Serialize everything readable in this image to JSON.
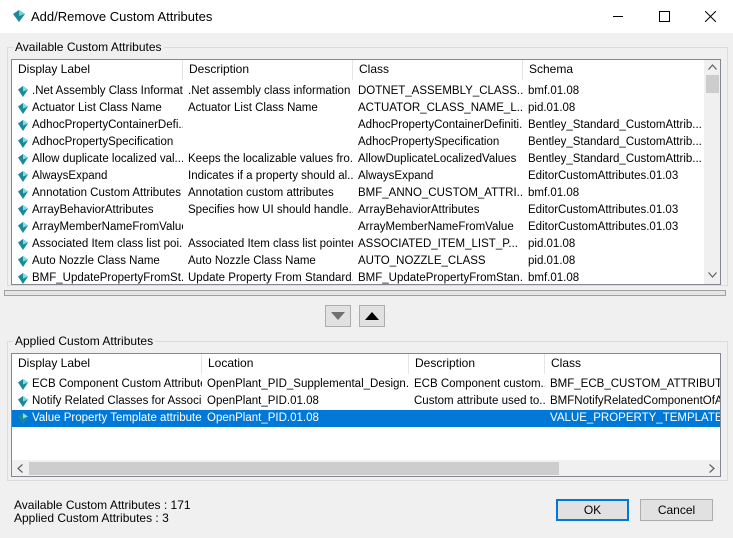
{
  "window": {
    "title": "Add/Remove Custom Attributes",
    "accent": "#0078d7"
  },
  "available": {
    "group_label": "Available Custom Attributes",
    "columns": [
      "Display Label",
      "Description",
      "Class",
      "Schema"
    ],
    "rows": [
      [
        ".Net Assembly Class Informat...",
        ".Net assembly class information",
        "DOTNET_ASSEMBLY_CLASS...",
        "bmf.01.08"
      ],
      [
        "Actuator List Class Name",
        "Actuator List Class Name",
        "ACTUATOR_CLASS_NAME_L...",
        "pid.01.08"
      ],
      [
        "AdhocPropertyContainerDefi...",
        "",
        "AdhocPropertyContainerDefiniti...",
        "Bentley_Standard_CustomAttrib..."
      ],
      [
        "AdhocPropertySpecification",
        "",
        "AdhocPropertySpecification",
        "Bentley_Standard_CustomAttrib..."
      ],
      [
        "Allow duplicate localized val...",
        "Keeps the localizable values fro...",
        "AllowDuplicateLocalizedValues",
        "Bentley_Standard_CustomAttrib..."
      ],
      [
        "AlwaysExpand",
        "Indicates if a property should al...",
        "AlwaysExpand",
        "EditorCustomAttributes.01.03"
      ],
      [
        "Annotation Custom Attributes",
        "Annotation custom attributes",
        "BMF_ANNO_CUSTOM_ATTRI...",
        "bmf.01.08"
      ],
      [
        "ArrayBehaviorAttributes",
        "Specifies how UI should handle...",
        "ArrayBehaviorAttributes",
        "EditorCustomAttributes.01.03"
      ],
      [
        "ArrayMemberNameFromValue",
        "",
        "ArrayMemberNameFromValue",
        "EditorCustomAttributes.01.03"
      ],
      [
        "Associated Item class list poi...",
        "Associated Item class list pointer",
        "ASSOCIATED_ITEM_LIST_P...",
        "pid.01.08"
      ],
      [
        "Auto Nozzle Class Name",
        "Auto Nozzle Class Name",
        "AUTO_NOZZLE_CLASS",
        "pid.01.08"
      ],
      [
        "BMF_UpdatePropertyFromSt...",
        "Update Property From Standard...",
        "BMF_UpdatePropertyFromStan...",
        "bmf.01.08"
      ]
    ]
  },
  "applied": {
    "group_label": "Applied Custom Attributes",
    "columns": [
      "Display Label",
      "Location",
      "Description",
      "Class"
    ],
    "rows": [
      [
        "ECB Component Custom Attributes",
        "OpenPlant_PID_Supplemental_Design...",
        "ECB Component custom...",
        "BMF_ECB_CUSTOM_ATTRIBUTE"
      ],
      [
        "Notify Related Classes for Associ...",
        "OpenPlant_PID.01.08",
        "Custom attribute used to...",
        "BMFNotifyRelatedComponentOfAsso"
      ],
      [
        "Value Property Template attribute",
        "OpenPlant_PID.01.08",
        "",
        "VALUE_PROPERTY_TEMPLATE_"
      ]
    ],
    "selected_row": 2
  },
  "status": {
    "available_count": "Available Custom Attributes : 171",
    "applied_count": "Applied Custom Attributes : 3"
  },
  "buttons": {
    "ok": "OK",
    "cancel": "Cancel",
    "move_down_icon": "triangle-down-icon",
    "move_up_icon": "triangle-up-icon"
  }
}
